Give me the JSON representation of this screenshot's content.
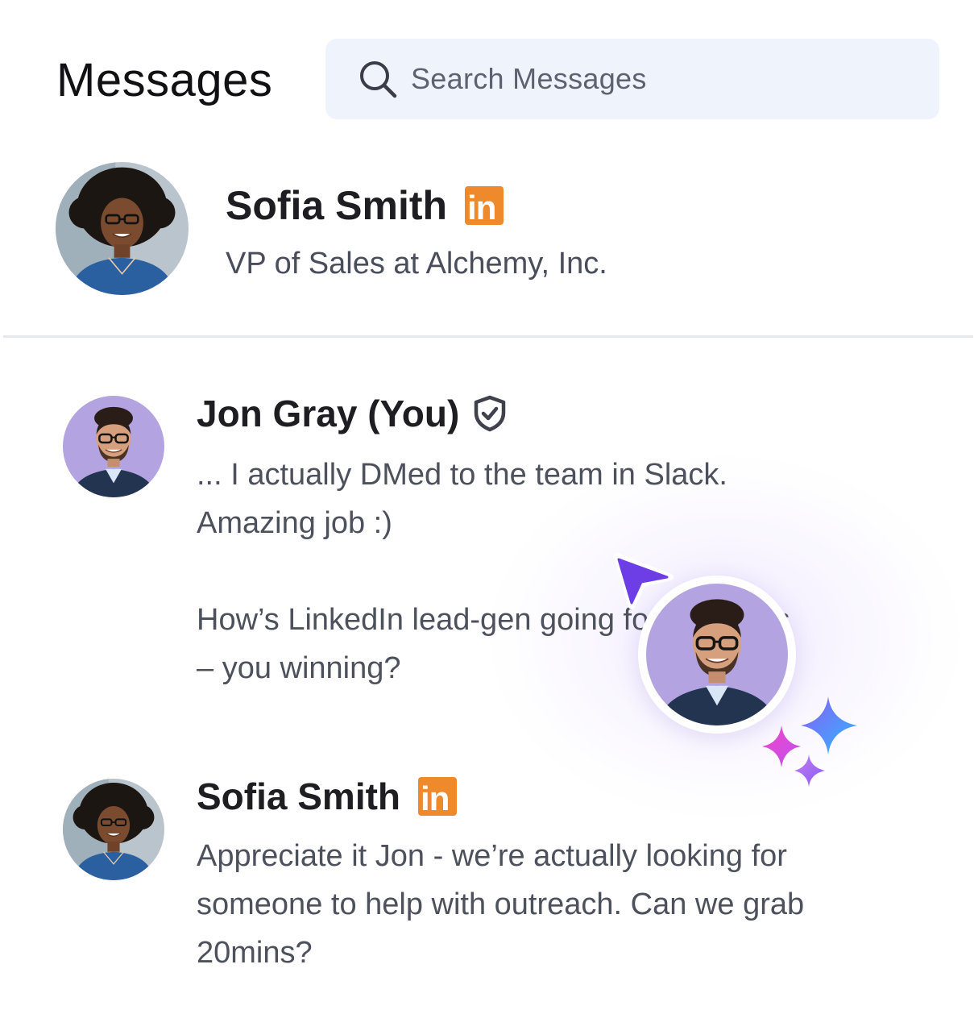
{
  "header": {
    "title": "Messages",
    "search_placeholder": "Search Messages"
  },
  "contact": {
    "name": "Sofia Smith",
    "subtitle": "VP of Sales at Alchemy, Inc.",
    "badge": "in"
  },
  "messages": [
    {
      "sender": "Jon Gray (You)",
      "badge_icon": "shield-check-icon",
      "lines": [
        "... I actually DMed to the team in Slack.",
        "Amazing job :)",
        "",
        "How’s LinkedIn lead-gen going for you guys",
        "– you winning?"
      ]
    },
    {
      "sender": "Sofia Smith",
      "badge": "in",
      "lines": [
        "Appreciate it Jon - we’re actually looking for",
        "someone to help with outreach. Can we grab",
        "20mins?"
      ]
    }
  ],
  "colors": {
    "linkedin_badge": "#ee8a2b",
    "search_bg": "#eff3fb",
    "cursor": "#6d3ee6",
    "sparkle_pink": "#f048c8",
    "sparkle_blue": "#2fb8ff",
    "sparkle_purple": "#9b5cf0"
  }
}
